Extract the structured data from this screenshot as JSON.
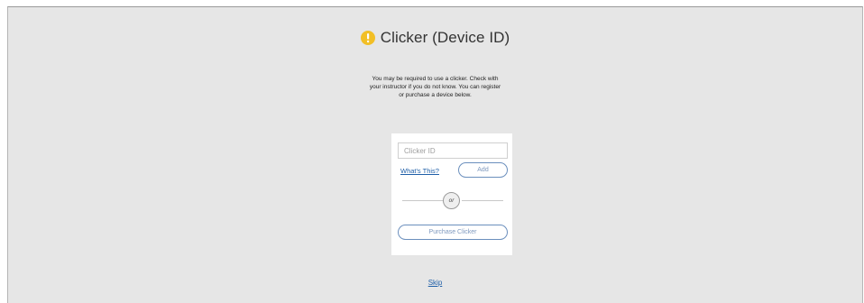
{
  "page": {
    "title": "Clicker (Device ID)",
    "title_icon": "warning-exclamation-icon",
    "description": "You may be required to use a clicker. Check with your instructor if you do not know. You can register or purchase a device below."
  },
  "form": {
    "clicker_input": {
      "value": "",
      "placeholder": "Clicker ID"
    },
    "whats_this_label": "What's This?",
    "add_label": "Add",
    "or_label": "or",
    "purchase_label": "Purchase Clicker"
  },
  "footer": {
    "skip_label": "Skip"
  },
  "colors": {
    "background": "#e6e6e6",
    "warning": "#f2bf26",
    "link": "#1f5fa8",
    "button_border": "#6b8fbd"
  }
}
